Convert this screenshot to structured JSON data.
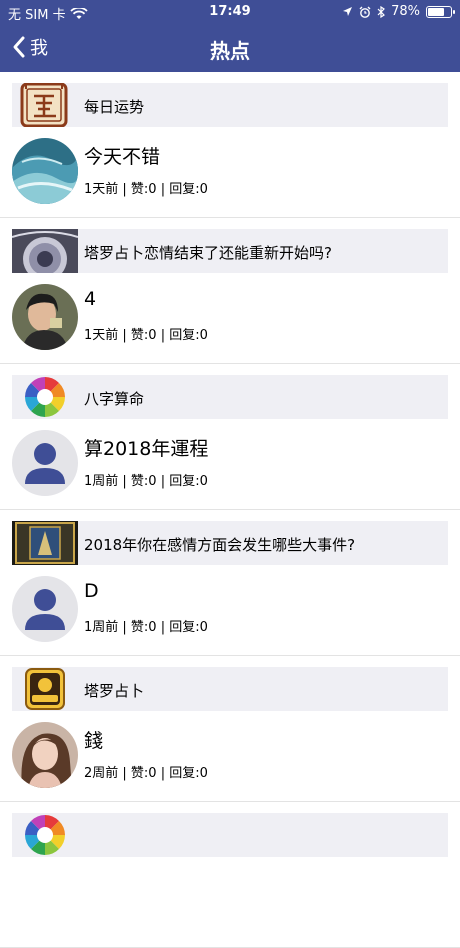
{
  "status_bar": {
    "carrier": "无 SIM 卡",
    "time": "17:49",
    "battery": "78%",
    "battery_level": 0.78
  },
  "nav": {
    "back_label": "我",
    "title": "热点"
  },
  "items": [
    {
      "category": "每日运势",
      "title": "今天不错",
      "meta": "1天前 | 赞:0 | 回复:0"
    },
    {
      "category": "塔罗占卜恋情结束了还能重新开始吗?",
      "title": "4",
      "meta": "1天前 | 赞:0 | 回复:0"
    },
    {
      "category": "八字算命",
      "title": "算2018年運程",
      "meta": "1周前 | 赞:0 | 回复:0"
    },
    {
      "category": "2018年你在感情方面会发生哪些大事件?",
      "title": "D",
      "meta": "1周前 | 赞:0 | 回复:0"
    },
    {
      "category": "塔罗占卜",
      "title": "錢",
      "meta": "2周前 | 赞:0 | 回复:0"
    },
    {
      "category": "",
      "title": "",
      "meta": ""
    }
  ],
  "icons": {
    "yun": "运 seal icon",
    "tarot_thumb": "tarot thumbnail",
    "color_wheel": "bazi color wheel",
    "tarot_card": "tarot card thumbnail",
    "tarot_badge": "tarot badge icon"
  },
  "colors": {
    "header": "#3f4e96",
    "tag_bg": "#efeff4",
    "default_avatar": "#3f4e96"
  }
}
